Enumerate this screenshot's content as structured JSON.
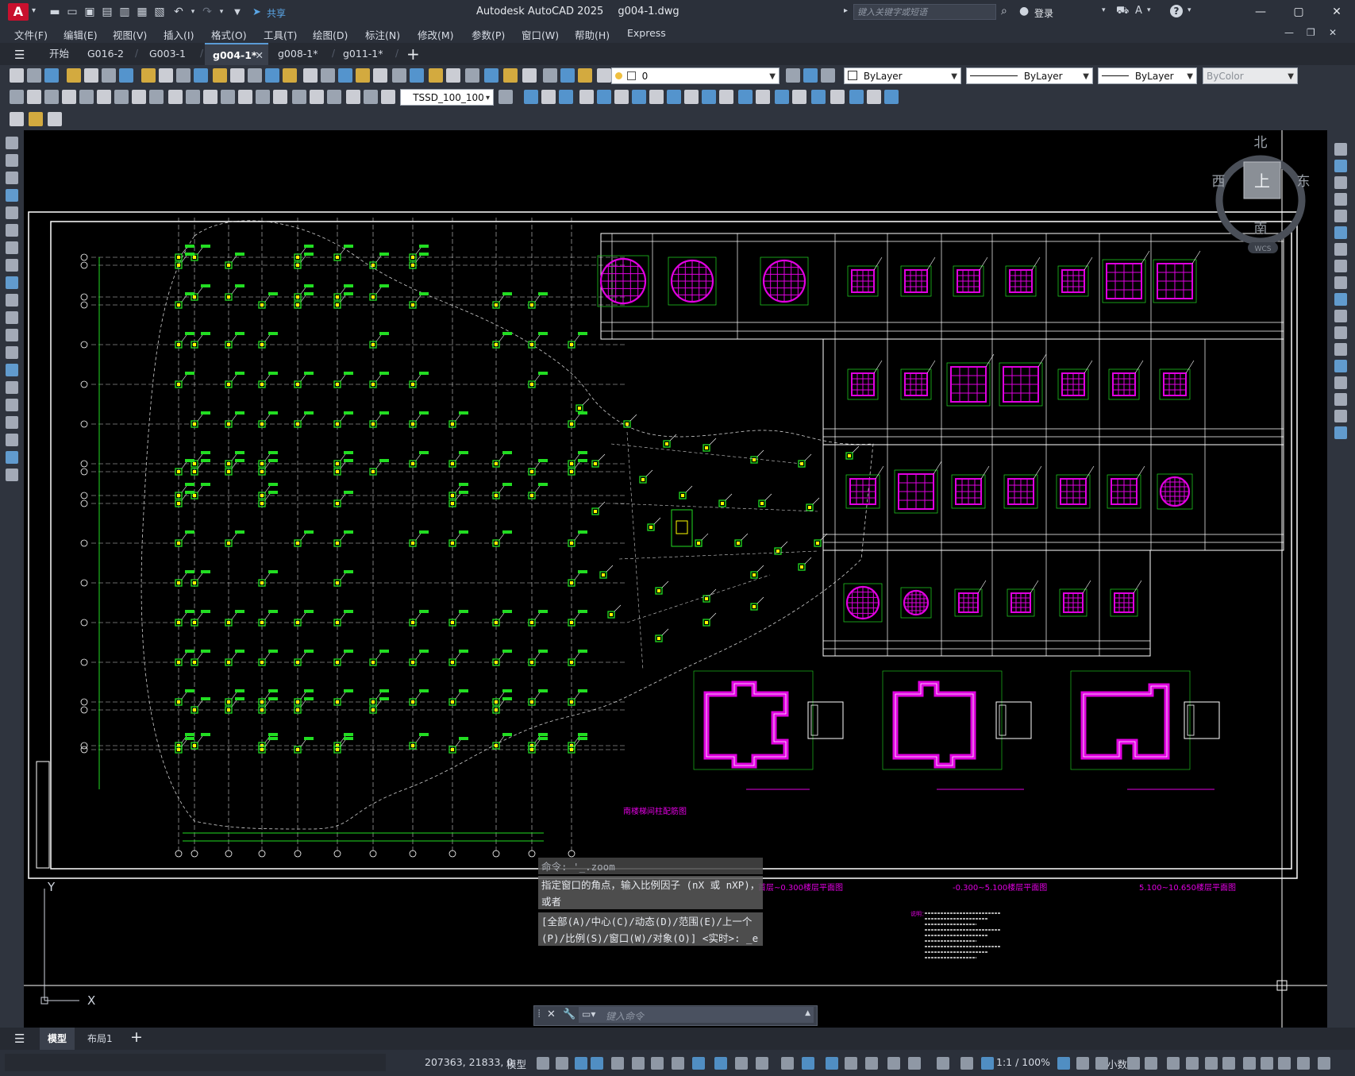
{
  "app": {
    "logo": "A",
    "title": "Autodesk AutoCAD 2025",
    "filename": "g004-1.dwg",
    "search_placeholder": "键入关键字或短语",
    "login": "登录",
    "share": "共享"
  },
  "menu": [
    "文件(F)",
    "编辑(E)",
    "视图(V)",
    "插入(I)",
    "格式(O)",
    "工具(T)",
    "绘图(D)",
    "标注(N)",
    "修改(M)",
    "参数(P)",
    "窗口(W)",
    "帮助(H)",
    "Express"
  ],
  "tabs": [
    {
      "label": "开始"
    },
    {
      "label": "G016-2"
    },
    {
      "label": "G003-1"
    },
    {
      "label": "g004-1*"
    },
    {
      "label": "g008-1*"
    },
    {
      "label": "g011-1*"
    }
  ],
  "toolbar": {
    "layer_value": "0",
    "color_value": "ByLayer",
    "linetype_value": "ByLayer",
    "lineweight_value": "ByLayer",
    "plotstyle_value": "ByColor",
    "dimstyle_value": "TSSD_100_100"
  },
  "viewcube": {
    "north": "北",
    "south": "南",
    "east": "东",
    "west": "西",
    "face": "上",
    "wcs": "WCS"
  },
  "ucs": {
    "x": "X",
    "y": "Y"
  },
  "drawing": {
    "caption_left": "首层~0.300楼层平面图",
    "caption_mid": "-0.300~5.100楼层平面图",
    "caption_right": "5.100~10.650楼层平面图",
    "caption_plan": "南楼梯间柱配筋图",
    "notes_label": "说明：",
    "colors": {
      "grid_green": "#22dd22",
      "rebar_magenta": "#e000e0",
      "tag_yellow": "#ffff00",
      "line_white": "#ffffff"
    }
  },
  "command": {
    "history": [
      "命令: '_.zoom",
      "指定窗口的角点，输入比例因子 (nX 或 nXP)，",
      "或者",
      "[全部(A)/中心(C)/动态(D)/范围(E)/上一个",
      "(P)/比例(S)/窗口(W)/对象(O)] <实时>: _e"
    ],
    "input_placeholder": "键入命令"
  },
  "layout_tabs": [
    "模型",
    "布局1"
  ],
  "status": {
    "coords": "207363, 21833, 0",
    "model": "模型",
    "scale": "1:1 / 100%",
    "units": "小数"
  }
}
